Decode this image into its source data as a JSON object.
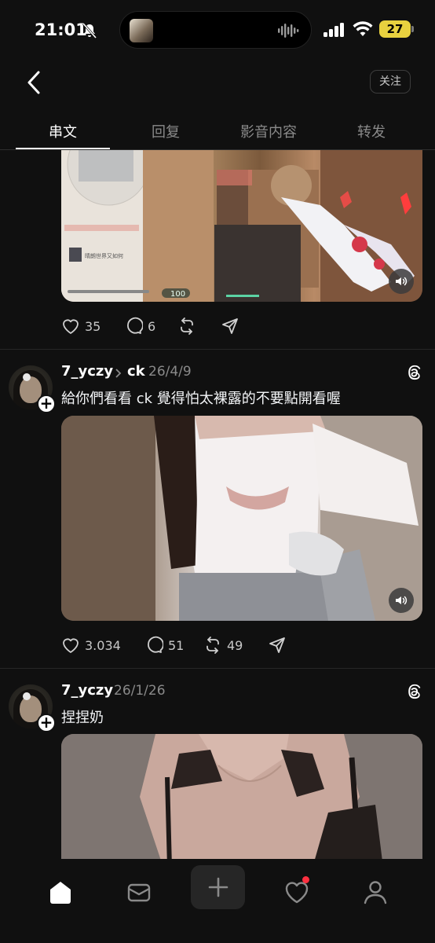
{
  "status_bar": {
    "time": "21:01",
    "battery": "27"
  },
  "header": {
    "follow_label": "关注"
  },
  "tabs": [
    {
      "label": "串文"
    },
    {
      "label": "回复"
    },
    {
      "label": "影音内容"
    },
    {
      "label": "转发"
    }
  ],
  "posts": [
    {
      "media_overlay": {
        "hp": "100",
        "chat_text": "晴朗世界又如何"
      },
      "likes": "35",
      "comments": "6"
    },
    {
      "username": "7_yczy",
      "reply_to": "ck",
      "date": "26/4/9",
      "text": "給你們看看 ck 覺得怕太裸露的不要點開看喔",
      "likes": "3.034",
      "comments": "51",
      "reposts": "49"
    },
    {
      "username": "7_yczy",
      "date": "26/1/26",
      "text": "捏捏奶"
    }
  ],
  "icons": {
    "back": "chevron-left-icon",
    "like": "heart-icon",
    "comment": "comment-icon",
    "repost": "repost-icon",
    "share": "send-icon",
    "threads": "threads-logo-icon",
    "volume": "speaker-icon",
    "nav": [
      "home-icon",
      "inbox-icon",
      "plus-icon",
      "activity-heart-icon",
      "profile-icon"
    ]
  },
  "colors": {
    "background": "#101010",
    "battery": "#e8d13f",
    "notification_dot": "#ff3040"
  }
}
